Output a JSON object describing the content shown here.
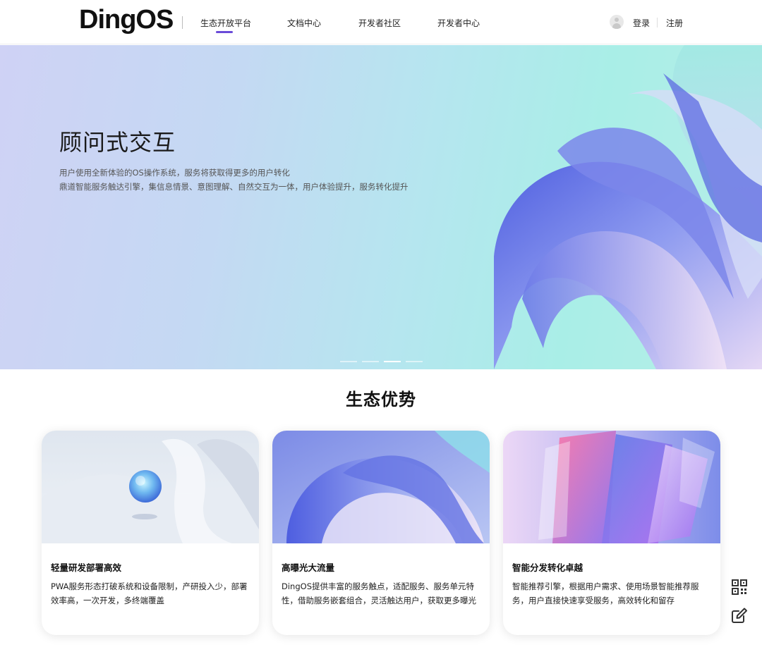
{
  "header": {
    "logo": "DingOS",
    "nav": [
      {
        "label": "生态开放平台",
        "active": true
      },
      {
        "label": "文档中心",
        "active": false
      },
      {
        "label": "开发者社区",
        "active": false
      },
      {
        "label": "开发者中心",
        "active": false
      }
    ],
    "login": "登录",
    "register": "注册"
  },
  "hero": {
    "title": "顾问式交互",
    "desc_line1": "用户使用全新体验的OS操作系统，服务将获取得更多的用户转化",
    "desc_line2": "鼎道智能服务触达引擎，集信息情景、意图理解、自然交互为一体，用户体验提升，服务转化提升",
    "carousel": {
      "count": 4,
      "active_index": 2
    }
  },
  "section": {
    "title": "生态优势",
    "cards": [
      {
        "title": "轻量研发部署高效",
        "desc": "PWA服务形态打破系统和设备限制，产研投入少，部署效率高，一次开发，多终端覆盖"
      },
      {
        "title": "高曝光大流量",
        "desc": "DingOS提供丰富的服务触点，适配服务、服务单元特性，借助服务嵌套组合，灵活触达用户，获取更多曝光"
      },
      {
        "title": "智能分发转化卓越",
        "desc": "智能推荐引擎，根据用户需求、使用场景智能推荐服务，用户直接快速享受服务，高效转化和留存"
      }
    ]
  },
  "side_tools": {
    "icons": [
      "qr-code-icon",
      "edit-icon"
    ]
  },
  "colors": {
    "accent": "#6a4bd8"
  }
}
